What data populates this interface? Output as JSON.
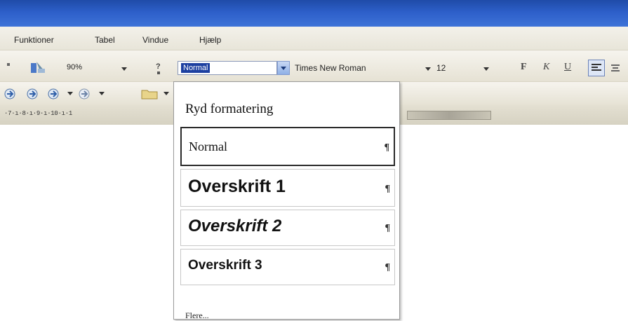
{
  "menu": [
    "Funktioner",
    "Tabel",
    "Vindue",
    "Hjælp"
  ],
  "toolbar": {
    "zoom": "90%",
    "style_value": "Normal",
    "font_name": "Times New Roman",
    "font_size": "12",
    "bold": "F",
    "italic": "K",
    "underline": "U"
  },
  "ruler": {
    "marks": "·7·ı·8·ı·9·ı·10·ı·1"
  },
  "style_dropdown": {
    "clear_formatting": "Ryd formatering",
    "items": [
      {
        "label": "Normal",
        "mark": "¶"
      },
      {
        "label": "Overskrift 1",
        "mark": "¶"
      },
      {
        "label": "Overskrift 2",
        "mark": "¶"
      },
      {
        "label": "Overskrift 3",
        "mark": "¶"
      }
    ],
    "more": "Flere..."
  },
  "colors": {
    "title_bar": "#2d5fc9",
    "selection": "#1c3fa0"
  }
}
